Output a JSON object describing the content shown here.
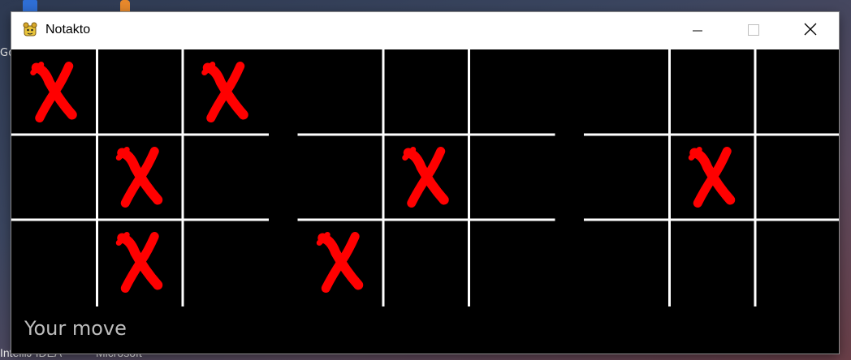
{
  "window": {
    "title": "Notakto",
    "icon": "python-snake-icon"
  },
  "controls": {
    "minimize_icon": "minimize-icon",
    "maximize_icon": "maximize-icon",
    "close_icon": "close-icon"
  },
  "desktop": {
    "side_text": "Go",
    "bottom_labels": [
      "IntelliJ IDEA",
      "Microsoft"
    ]
  },
  "game": {
    "status": "Your move",
    "grid_color": "#ffffff",
    "mark_color": "#ff0000",
    "mark_symbol": "X",
    "boards": [
      {
        "name": "board-1",
        "cells": [
          "X",
          "",
          "X",
          "",
          "X",
          "",
          "",
          "X",
          ""
        ]
      },
      {
        "name": "board-2",
        "cells": [
          "",
          "",
          "",
          "",
          "X",
          "",
          "X",
          "",
          ""
        ]
      },
      {
        "name": "board-3",
        "cells": [
          "",
          "",
          "",
          "",
          "X",
          "",
          "",
          "",
          ""
        ]
      }
    ]
  }
}
